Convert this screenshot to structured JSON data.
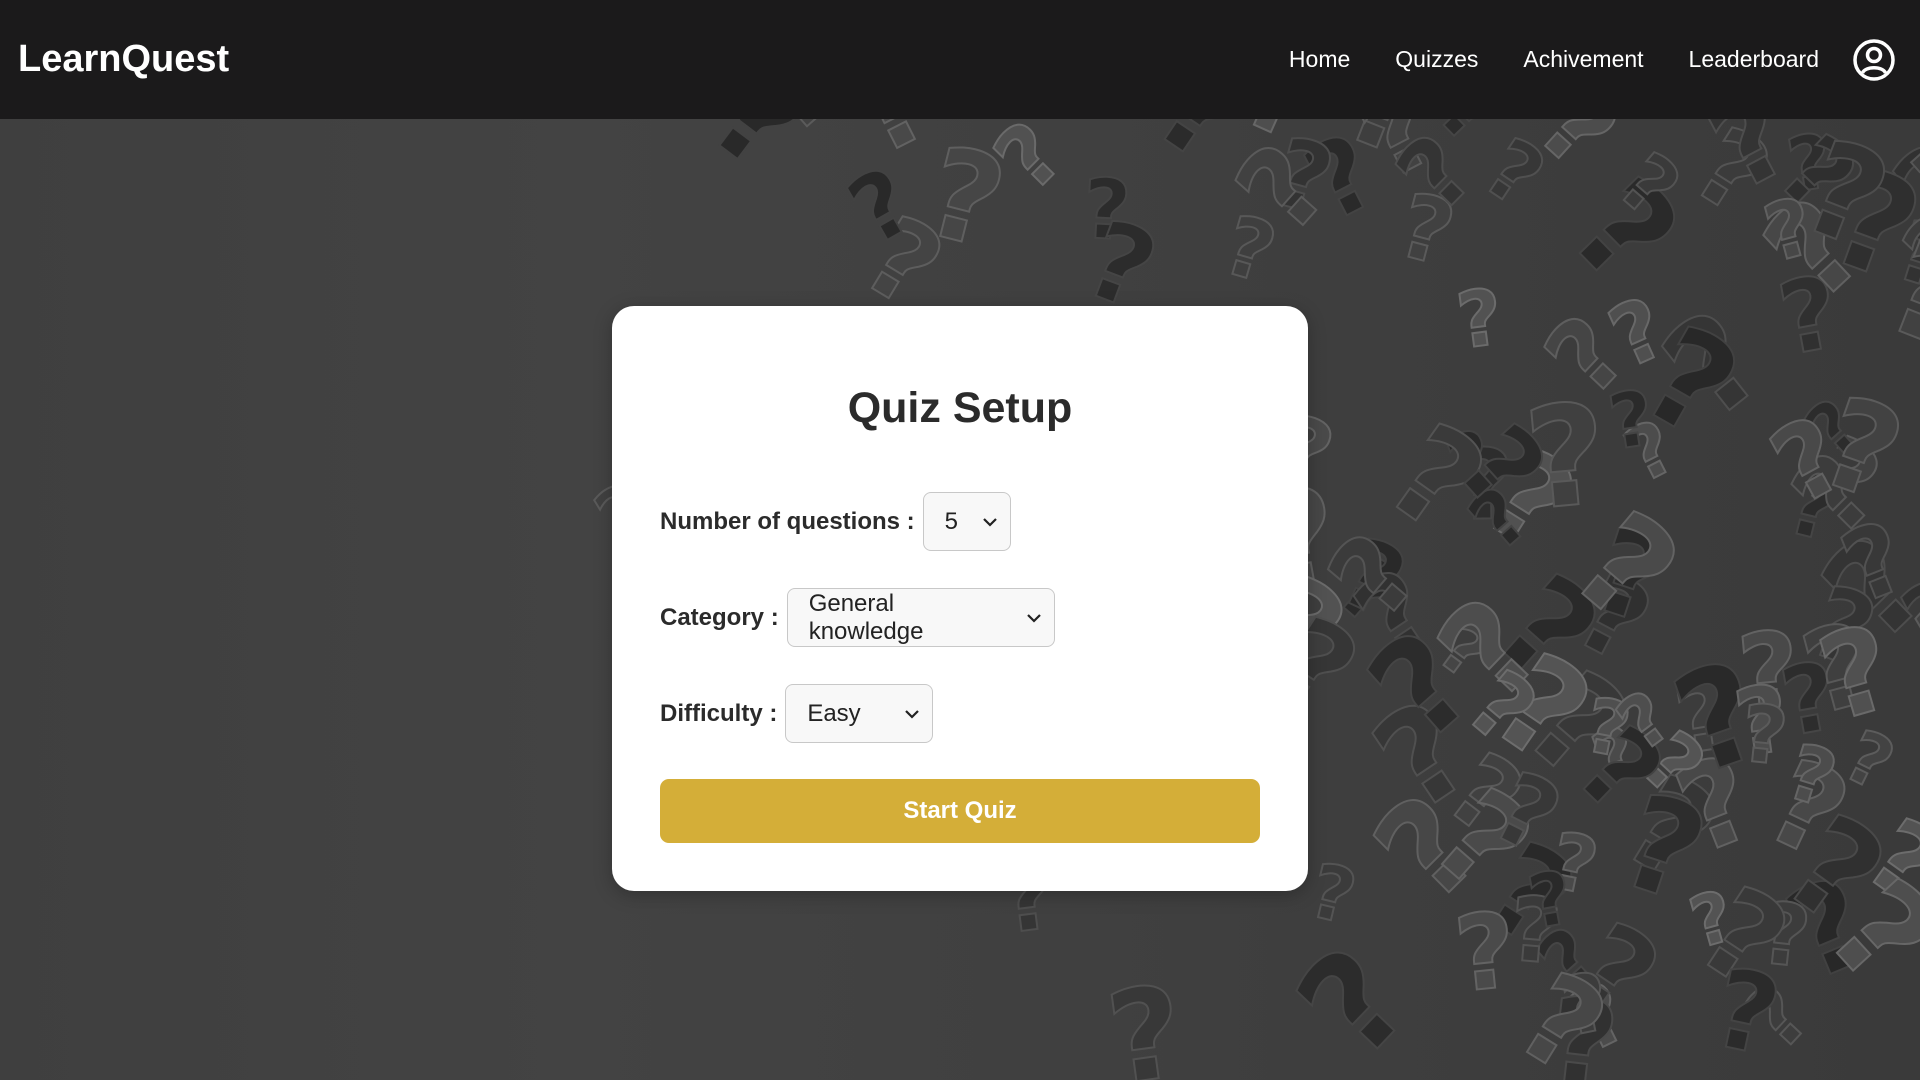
{
  "app": {
    "brand": "LearnQuest"
  },
  "nav": {
    "items": [
      {
        "label": "Home"
      },
      {
        "label": "Quizzes"
      },
      {
        "label": "Achivement"
      },
      {
        "label": "Leaderboard"
      }
    ],
    "profile_icon": "user-circle-icon"
  },
  "quiz_setup": {
    "title": "Quiz Setup",
    "num_questions": {
      "label": "Number of questions :",
      "value": "5"
    },
    "category": {
      "label": "Category :",
      "value": "General knowledge"
    },
    "difficulty": {
      "label": "Difficulty :",
      "value": "Easy"
    },
    "start_button": "Start Quiz"
  },
  "colors": {
    "navbar": "#1b1a1b",
    "accent": "#d4ae38",
    "background": "#3c3c3c",
    "card": "#ffffff"
  },
  "background_pattern": "question-marks-pattern"
}
